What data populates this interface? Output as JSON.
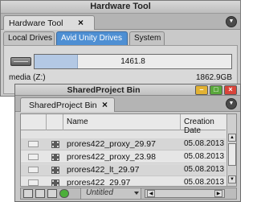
{
  "hardware_tool": {
    "title": "Hardware Tool",
    "tab_label": "Hardware Tool",
    "close_glyph": "×",
    "subtabs": [
      "Local Drives",
      "Avid Unity Drives",
      "System"
    ],
    "active_subtab": "Avid Unity Drives",
    "drive": {
      "name": "media (Z:)",
      "bar_value": "1461.8",
      "capacity": "1862.9GB",
      "used_fraction": 0.22
    }
  },
  "bin": {
    "title": "SharedProject Bin",
    "tab_label": "SharedProject Bin",
    "close_glyph": "×",
    "columns": {
      "name": "Name",
      "date": "Creation Date"
    },
    "rows": [
      {
        "name": "prores422_proxy_29.97",
        "date": "05.08.2013"
      },
      {
        "name": "prores422_proxy_23.98",
        "date": "05.08.2013"
      },
      {
        "name": "prores422_lt_29.97",
        "date": "05.08.2013"
      },
      {
        "name": "prores422_29.97",
        "date": "05.08.2013"
      }
    ],
    "bottom": {
      "view_name": "Untitled"
    }
  },
  "colors": {
    "accent_tab": "#4e8fd3",
    "minimize": "#e2b233",
    "maximize": "#5aa83c",
    "close": "#d9443a"
  },
  "icons": [
    "close-icon",
    "menu-chevron-icon",
    "drive-icon",
    "clip-icon",
    "scroll-arrow-icon",
    "view-icon"
  ]
}
